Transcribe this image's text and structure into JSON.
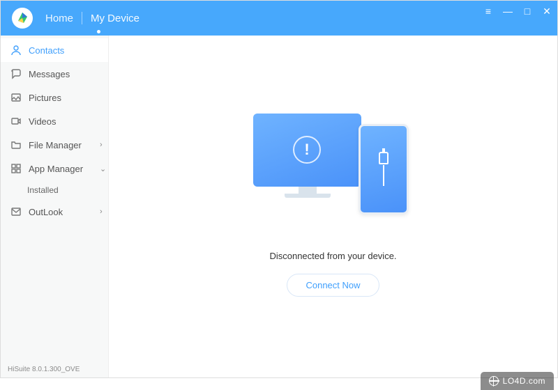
{
  "header": {
    "home_label": "Home",
    "device_label": "My Device"
  },
  "win": {
    "menu": "≡",
    "min": "—",
    "max": "□",
    "close": "✕"
  },
  "sidebar": {
    "items": [
      {
        "icon": "contact",
        "label": "Contacts",
        "active": true
      },
      {
        "icon": "chat",
        "label": "Messages"
      },
      {
        "icon": "image",
        "label": "Pictures"
      },
      {
        "icon": "video",
        "label": "Videos"
      },
      {
        "icon": "folder",
        "label": "File Manager",
        "chev": "›"
      },
      {
        "icon": "apps",
        "label": "App Manager",
        "chev": "⌄",
        "sub": "Installed"
      },
      {
        "icon": "mail",
        "label": "OutLook",
        "chev": "›"
      }
    ],
    "version": "HiSuite 8.0.1.300_OVE"
  },
  "main": {
    "status": "Disconnected from your device.",
    "connect_label": "Connect Now"
  },
  "watermark": "LO4D.com"
}
